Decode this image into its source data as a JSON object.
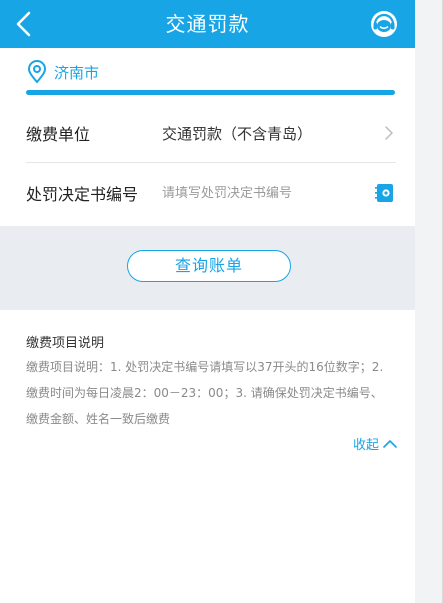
{
  "header": {
    "title": "交通罚款",
    "back_icon": "chevron-left-icon",
    "service_icon": "customer-service-icon"
  },
  "location": {
    "icon": "location-pin-icon",
    "city": "济南市"
  },
  "form": {
    "payee": {
      "label": "缴费单位",
      "value": "交通罚款（不含青岛）",
      "icon": "chevron-right-icon"
    },
    "decision_no": {
      "label": "处罚决定书编号",
      "placeholder": "请填写处罚决定书编号",
      "value": "",
      "icon": "scan-card-icon"
    }
  },
  "actions": {
    "query_label": "查询账单"
  },
  "notes": {
    "title": "缴费项目说明",
    "body": "缴费项目说明：1. 处罚决定书编号请填写以37开头的16位数字；2. 缴费时间为每日凌晨2：00－23：00；3. 请确保处罚决定书编号、缴费金额、姓名一致后缴费",
    "collapse_label": "收起",
    "collapse_icon": "chevron-up-icon"
  },
  "colors": {
    "brand": "#18a5e6",
    "band": "#e9edf1"
  }
}
